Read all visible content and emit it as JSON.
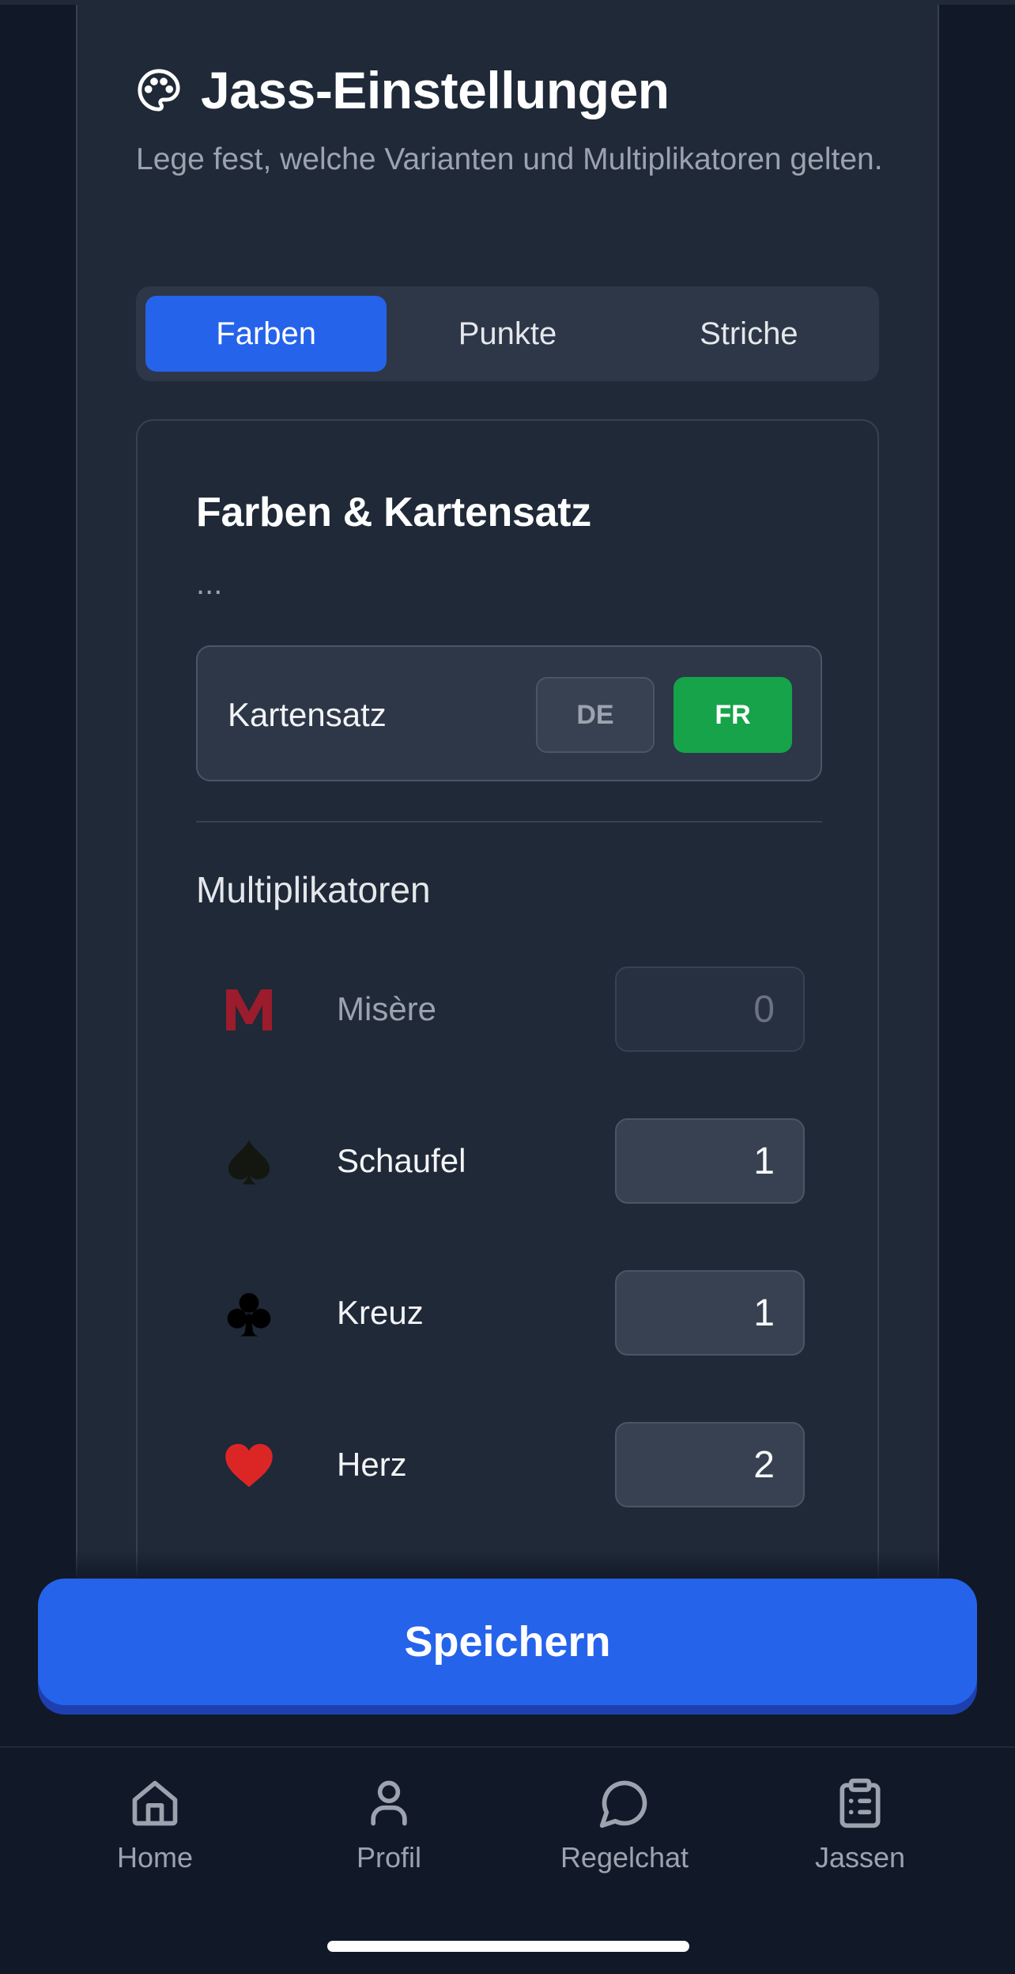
{
  "header": {
    "title": "Jass-Einstellungen",
    "subtitle": "Lege fest, welche Varianten und Multiplikatoren gelten.",
    "icon": "palette-icon"
  },
  "tabs": [
    {
      "label": "Farben",
      "active": true
    },
    {
      "label": "Punkte",
      "active": false
    },
    {
      "label": "Striche",
      "active": false
    }
  ],
  "panel": {
    "title": "Farben & Kartensatz",
    "description": "...",
    "deck": {
      "label": "Kartensatz",
      "options": [
        {
          "label": "DE",
          "selected": false
        },
        {
          "label": "FR",
          "selected": true
        }
      ]
    },
    "multipliers_title": "Multiplikatoren",
    "multipliers": [
      {
        "label": "Misère",
        "value": "0",
        "icon": "misere-m-icon",
        "disabled": true
      },
      {
        "label": "Schaufel",
        "value": "1",
        "icon": "spade-icon",
        "disabled": false
      },
      {
        "label": "Kreuz",
        "value": "1",
        "icon": "club-icon",
        "disabled": false
      },
      {
        "label": "Herz",
        "value": "2",
        "icon": "heart-icon",
        "disabled": false
      }
    ]
  },
  "save_button": "Speichern",
  "nav": [
    {
      "label": "Home",
      "icon": "home-icon"
    },
    {
      "label": "Profil",
      "icon": "user-icon"
    },
    {
      "label": "Regelchat",
      "icon": "chat-bubble-icon"
    },
    {
      "label": "Jassen",
      "icon": "clipboard-icon"
    }
  ],
  "colors": {
    "accent": "#2563eb",
    "selected_deck": "#16a34a",
    "background": "#111827",
    "card": "#1f2937",
    "misere": "#9b1c2c",
    "heart": "#dc2626"
  }
}
